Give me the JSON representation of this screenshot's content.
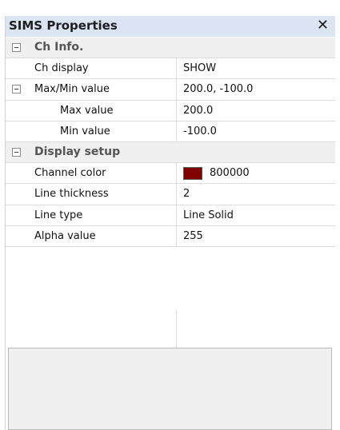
{
  "panel": {
    "title": "SIMS Properties",
    "close_icon": "close-icon"
  },
  "grid": {
    "categories": [
      {
        "label": "Ch Info.",
        "rows": [
          {
            "name": "Ch display",
            "value": "SHOW"
          }
        ]
      },
      {
        "label": "Max/Min value",
        "value": "200.0, -100.0",
        "rows": [
          {
            "name": "Max value",
            "value": "200.0"
          },
          {
            "name": "Min value",
            "value": "-100.0"
          }
        ]
      },
      {
        "label": "Display setup",
        "rows": [
          {
            "name": "Channel color",
            "value": "800000",
            "swatch_color": "#800000"
          },
          {
            "name": "Line thickness",
            "value": "2"
          },
          {
            "name": "Line type",
            "value": "Line Solid"
          },
          {
            "name": "Alpha value",
            "value": "255"
          }
        ]
      }
    ]
  },
  "colors": {
    "title_bar": "#dbe4f3",
    "category_bg": "#f0f0f0",
    "channel_color": "#800000"
  }
}
